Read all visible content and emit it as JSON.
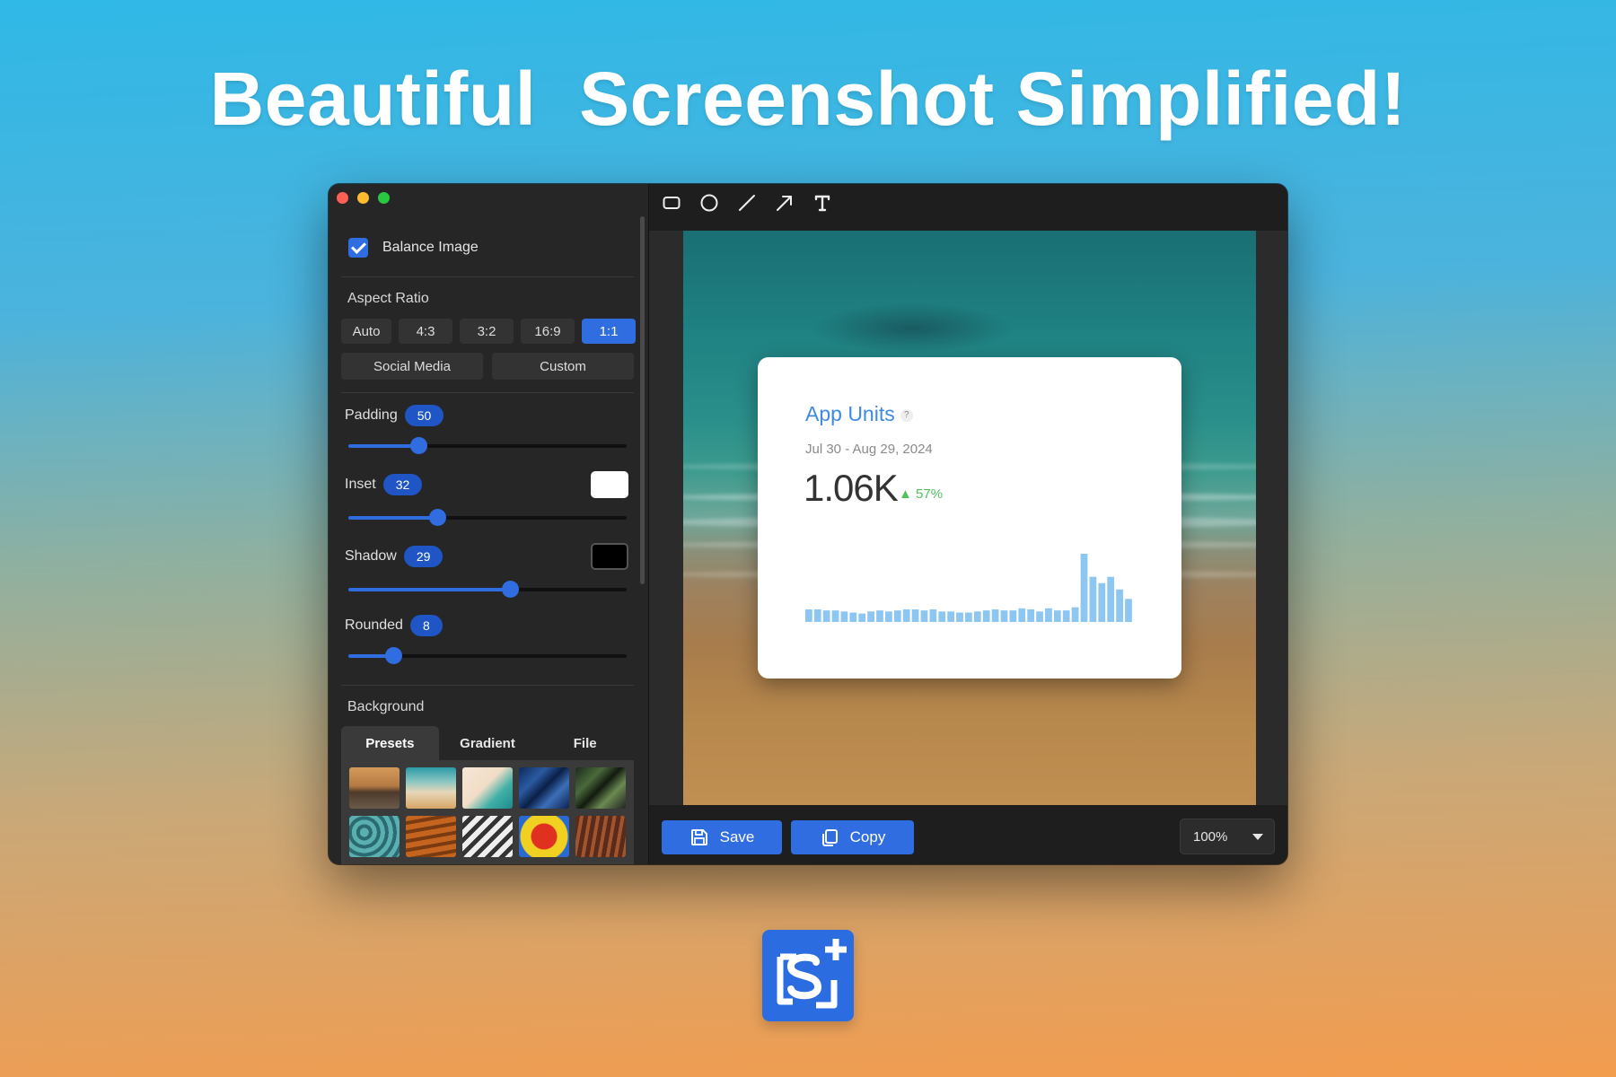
{
  "headline": "Beautiful  Screenshot Simplified!",
  "sidebar": {
    "balance_image_label": "Balance Image",
    "aspect_ratio": {
      "title": "Aspect Ratio",
      "options": [
        "Auto",
        "4:3",
        "3:2",
        "16:9",
        "1:1"
      ],
      "selected": "1:1",
      "extra_options": [
        "Social Media",
        "Custom"
      ]
    },
    "padding": {
      "label": "Padding",
      "value": "50",
      "fraction": 0.25
    },
    "inset": {
      "label": "Inset",
      "value": "32",
      "fraction": 0.32,
      "color": "#ffffff"
    },
    "shadow": {
      "label": "Shadow",
      "value": "29",
      "fraction": 0.58,
      "color": "#000000"
    },
    "rounded": {
      "label": "Rounded",
      "value": "8",
      "fraction": 0.16
    },
    "background": {
      "title": "Background",
      "tabs": [
        "Presets",
        "Gradient",
        "File"
      ],
      "active_tab": "Presets"
    }
  },
  "toolbar": {
    "tools": [
      "rectangle-tool",
      "circle-tool",
      "line-tool",
      "arrow-tool",
      "text-tool"
    ]
  },
  "preview": {
    "card_title": "App Units",
    "help_mark": "?",
    "date_range": "Jul 30 - Aug 29, 2024",
    "value": "1.06K",
    "delta": "57%",
    "chart_data": {
      "type": "bar",
      "values": [
        12,
        12,
        11,
        11,
        10,
        9,
        8,
        10,
        11,
        10,
        11,
        12,
        12,
        11,
        12,
        10,
        10,
        9,
        9,
        10,
        11,
        12,
        11,
        11,
        13,
        12,
        10,
        13,
        11,
        11,
        14,
        65,
        43,
        37,
        43,
        31,
        22
      ]
    }
  },
  "bottom": {
    "save_label": "Save",
    "copy_label": "Copy",
    "zoom_value": "100%"
  },
  "colors": {
    "accent": "#2f6de1",
    "chart_bar": "#8cc6f1",
    "delta_green": "#4cc35c"
  }
}
